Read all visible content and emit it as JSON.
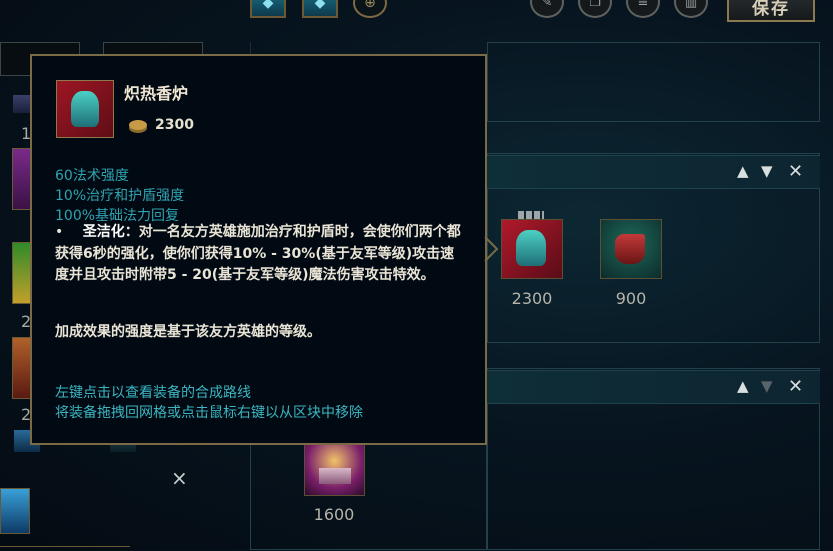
{
  "toolbar": {
    "save_label": "保存",
    "icons": [
      "recommended-items-icon",
      "item-sets-icon",
      "lock-icon",
      "edit-icon",
      "copy-icon",
      "clear-list-icon",
      "delete-icon"
    ]
  },
  "left_column": {
    "number_fragments": [
      "1",
      "2",
      "2"
    ],
    "close_glyph": "×"
  },
  "section_one": {
    "items": [
      {
        "name": "炽热香炉",
        "price": "2300"
      },
      {
        "name": "",
        "price": "900"
      }
    ]
  },
  "section_two": {
    "items": [
      {
        "name": "",
        "price": "1600"
      }
    ]
  },
  "tooltip": {
    "title": "炽热香炉",
    "cost": "2300",
    "stats": [
      "60法术强度",
      "10%治疗和护盾强度",
      "100%基础法力回复"
    ],
    "bullet": "•",
    "passive_name": "圣洁化",
    "passive_text": "：对一名友方英雄施加治疗和护盾时，会使你们两个都获得6秒的强化，使你们获得10% - 30%(基于友军等级)攻击速度并且攻击时附带5 - 20(基于友军等级)魔法伤害攻击特效。",
    "note": "加成效果的强度是基于该友方英雄的等级。",
    "hints": [
      "左键点击以查看装备的合成路线",
      "将装备拖拽回网格或点击鼠标右键以从区块中移除"
    ]
  },
  "colors": {
    "accent_gold": "#7a6a45",
    "stat_teal": "#2fa3b0",
    "hint_teal": "#3bb6c2",
    "background": "#040b12"
  }
}
